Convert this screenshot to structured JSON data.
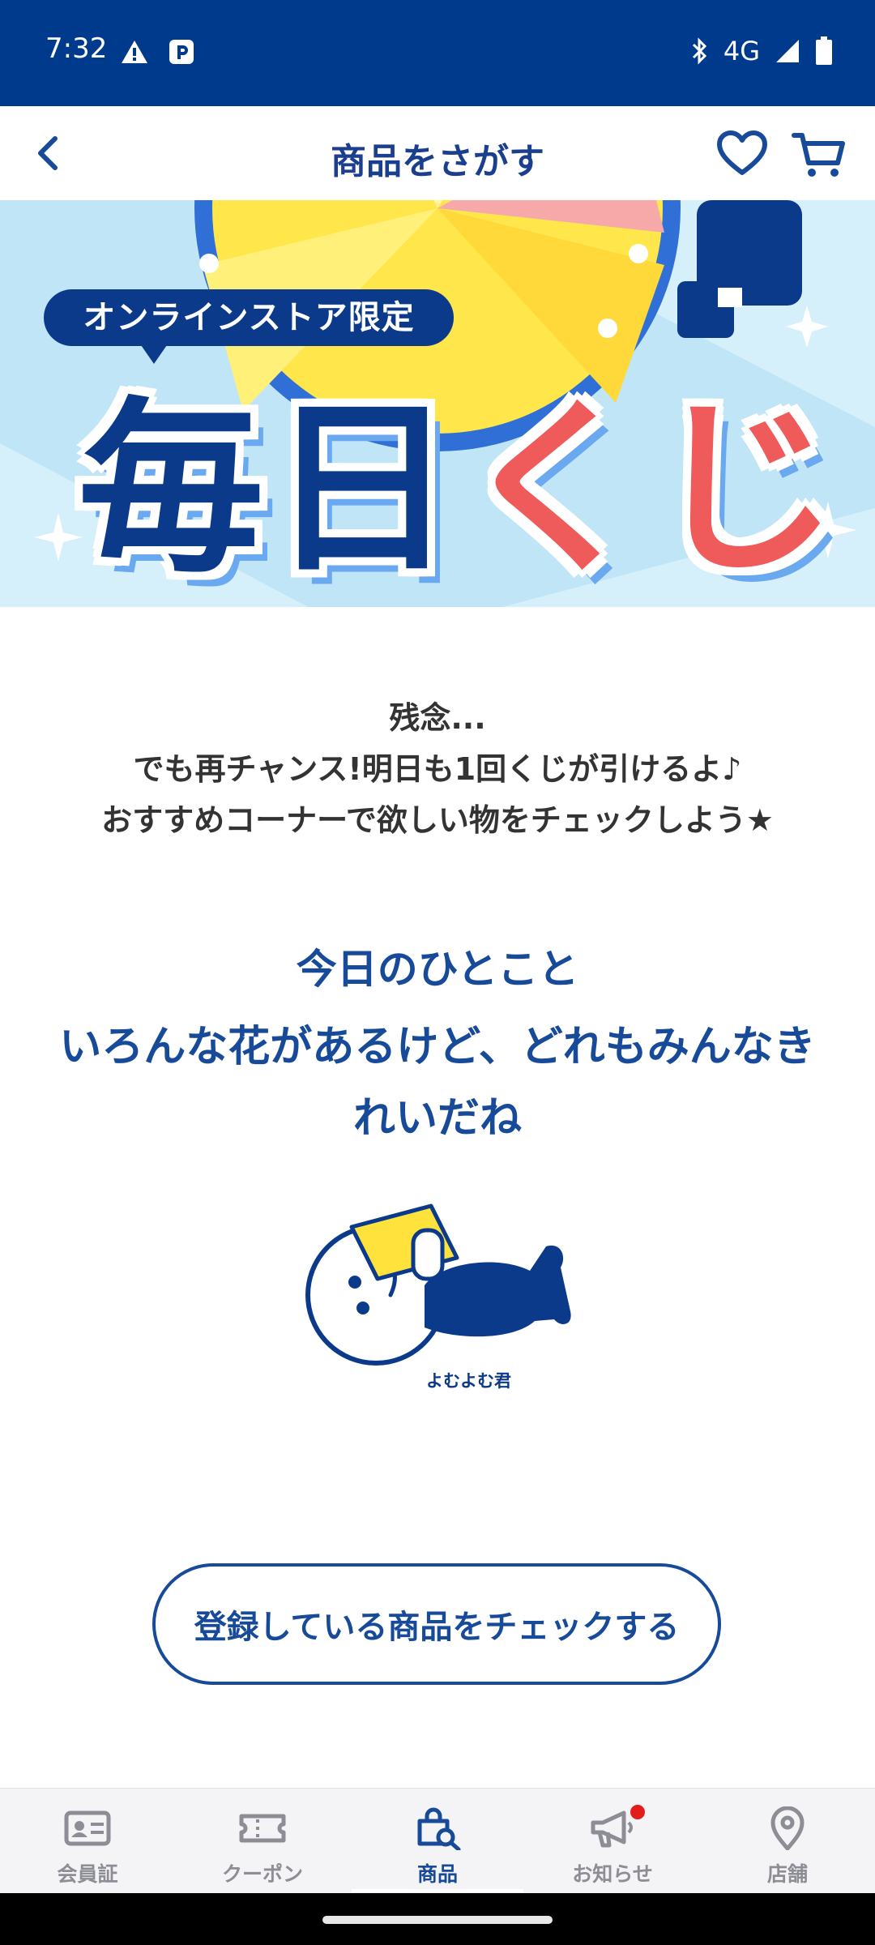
{
  "status_bar": {
    "time": "7:32",
    "network": "4G"
  },
  "header": {
    "title": "商品をさがす"
  },
  "banner": {
    "ribbon": "オンラインストア限定",
    "title_blue": "毎日",
    "title_red": "くじ"
  },
  "result": {
    "line1": "残念...",
    "line2": "でも再チャンス!明日も1回くじが引けるよ♪",
    "line3": "おすすめコーナーで欲しい物をチェックしよう★"
  },
  "hitokoto": {
    "title": "今日のひとこと",
    "body": "いろんな花があるけど、どれもみんなきれいだね"
  },
  "character": {
    "label": "よむよむ君"
  },
  "cta": {
    "label": "登録している商品をチェックする"
  },
  "bottom_nav": {
    "items": [
      {
        "label": "会員証",
        "icon": "member-card-icon",
        "active": false
      },
      {
        "label": "クーポン",
        "icon": "coupon-icon",
        "active": false
      },
      {
        "label": "商品",
        "icon": "product-search-icon",
        "active": true
      },
      {
        "label": "お知らせ",
        "icon": "megaphone-icon",
        "active": false
      },
      {
        "label": "店舗",
        "icon": "location-pin-icon",
        "active": false
      }
    ]
  },
  "colors": {
    "brand": "#003a8c",
    "text_blue": "#174a99",
    "banner_bg": "#bfe5f7",
    "accent_red": "#ef5b5b"
  }
}
